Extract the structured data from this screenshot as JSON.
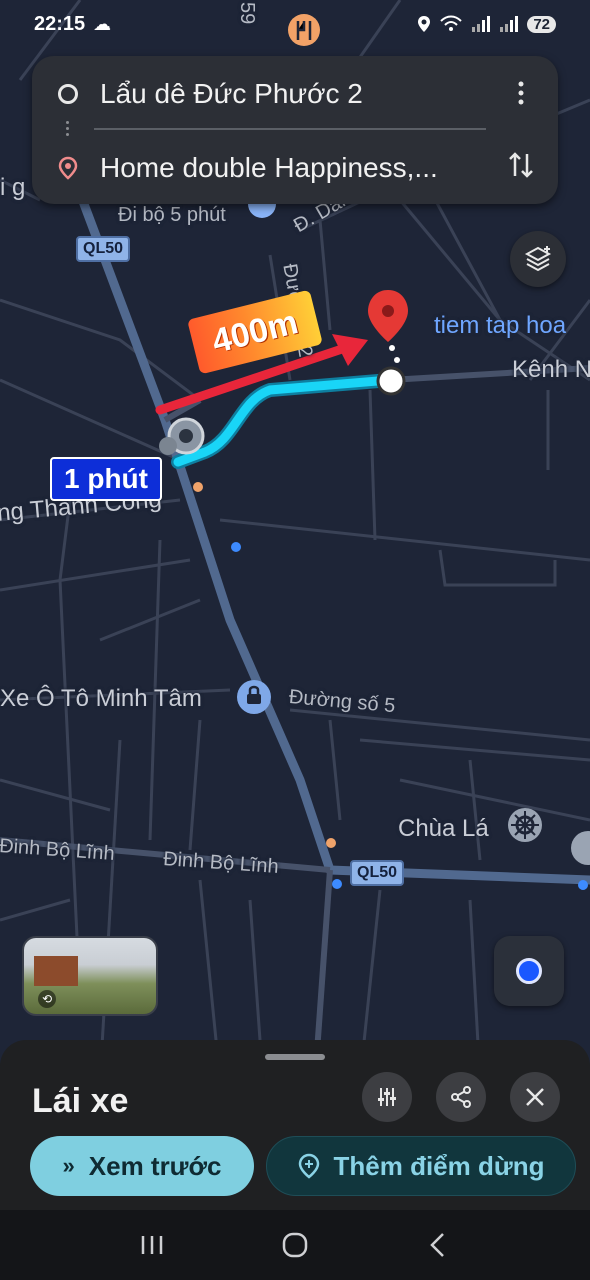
{
  "status_bar": {
    "time": "22:15",
    "battery": "72"
  },
  "directions": {
    "origin": "Lẩu dê Đức Phước 2",
    "destination": "Home double Happiness,..."
  },
  "map": {
    "labels": {
      "walk": "Đi bộ 5 phút",
      "street_dan": "Đ. Dân",
      "street_n2": "Đường N2",
      "tiem": "tiem tap hoa",
      "kenh": "Kênh N",
      "thanh_cong": "ng Thanh Công",
      "minh_tam": "Xe Ô Tô Minh Tâm",
      "duong_so5": "Đường số 5",
      "chua_la": "Chùa Lá",
      "dinh_bo_linh_1": "Đinh Bộ Lĩnh",
      "dinh_bo_linh_2": "Đinh Bộ Lĩnh",
      "gi": "i g",
      "num59": "59"
    },
    "shields": {
      "ql50_top": "QL50",
      "ql50_bottom": "QL50"
    }
  },
  "annotations": {
    "distance": "400m",
    "duration": "1 phút"
  },
  "bottom_sheet": {
    "mode": "Lái xe",
    "preview_label": "Xem trước",
    "add_stop_label": "Thêm điểm dừng"
  },
  "colors": {
    "route": "#19c9f2",
    "arrow": "#e8263a",
    "accent": "#7fcfe0"
  }
}
